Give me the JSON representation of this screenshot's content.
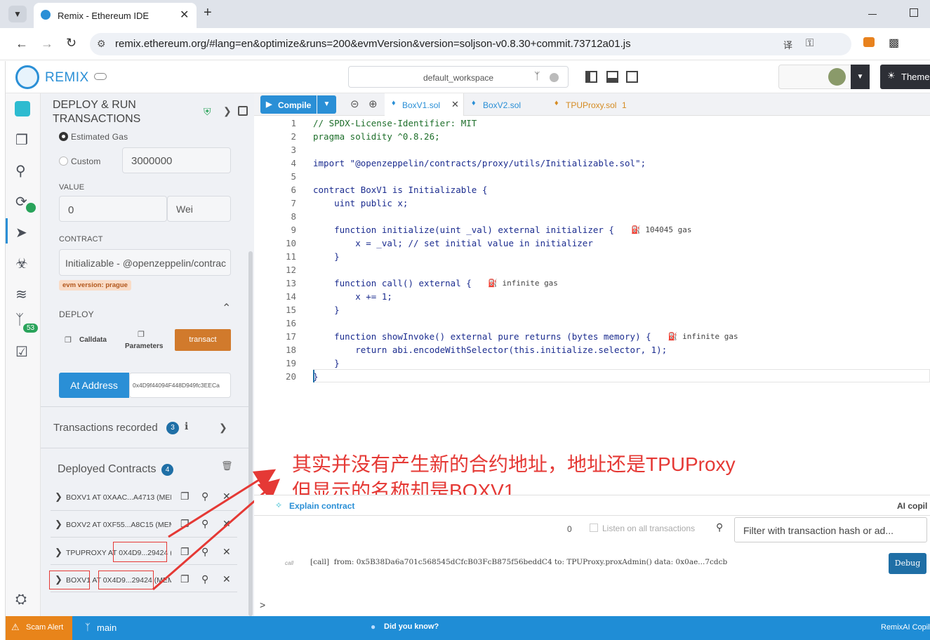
{
  "browser": {
    "tab_title": "Remix - Ethereum IDE",
    "url": "remix.ethereum.org/#lang=en&optimize&runs=200&evmVersion&version=soljson-v0.8.30+commit.73712a01.js"
  },
  "header": {
    "brand": "REMIX",
    "workspace": "default_workspace",
    "theme_label": "Theme"
  },
  "iconbar": {
    "badge_count": "53"
  },
  "side": {
    "title_line1": "DEPLOY & RUN",
    "title_line2": "TRANSACTIONS",
    "gas_estimated": "Estimated Gas",
    "gas_custom": "Custom",
    "gas_custom_value": "3000000",
    "value_label": "VALUE",
    "value_amount": "0",
    "value_unit": "Wei",
    "contract_label": "CONTRACT",
    "contract_value": "Initializable - @openzeppelin/contrac",
    "evm_badge": "evm version: prague",
    "deploy_label": "DEPLOY",
    "calldata_label": "Calldata",
    "parameters_label": "Parameters",
    "transact_label": "transact",
    "at_address_label": "At Address",
    "at_address_value": "0x4D9f44094F448D949fc3EECa",
    "tx_recorded": "Transactions recorded",
    "tx_count": "3",
    "deployed_label": "Deployed Contracts",
    "deployed_count": "4",
    "deployed": [
      {
        "name": "BOXV1 AT 0XAAC...A4713 (MEM"
      },
      {
        "name": "BOXV2 AT 0XF55...A8C15 (MEM"
      },
      {
        "name": "TPUPROXY AT 0X4D9...29424 (M"
      },
      {
        "name": "BOXV1 AT 0X4D9...29424 (MEM"
      }
    ]
  },
  "editor": {
    "compile_label": "Compile",
    "tabs": [
      {
        "label": "BoxV1.sol",
        "badge": ""
      },
      {
        "label": "BoxV2.sol",
        "badge": ""
      },
      {
        "label": "TPUProxy.sol",
        "badge": "1"
      }
    ],
    "lines": [
      "// SPDX-License-Identifier: MIT",
      "pragma solidity ^0.8.26;",
      "",
      "import \"@openzeppelin/contracts/proxy/utils/Initializable.sol\";",
      "",
      "contract BoxV1 is Initializable {",
      "    uint public x;",
      "",
      "    function initialize(uint _val) external initializer {",
      "        x = _val; // set initial value in initializer",
      "    }",
      "",
      "    function call() external {",
      "        x += 1;",
      "    }",
      "",
      "    function showInvoke() external pure returns (bytes memory) {",
      "        return abi.encodeWithSelector(this.initialize.selector, 1);",
      "    }",
      "}"
    ],
    "gas_hints": [
      {
        "line": 9,
        "text": "104045 gas"
      },
      {
        "line": 13,
        "text": "infinite gas"
      },
      {
        "line": 17,
        "text": "infinite gas"
      }
    ]
  },
  "annotation": {
    "line1": "其实并没有产生新的合约地址，地址还是TPUProxy",
    "line2": "但显示的名称却是BOXV1"
  },
  "terminal": {
    "explain_label": "Explain contract",
    "ai_label": "AI copil",
    "count": "0",
    "listen_label": "Listen on all transactions",
    "filter_placeholder": "Filter with transaction hash or ad...",
    "call_tag": "call",
    "log_line": "[call]  from: 0x5B38Da6a701c568545dCfcB03FcB875f56beddC4 to: TPUProxy.proxAdmin() data: 0x0ae...7cdcb",
    "debug_label": "Debug",
    "prompt": ">"
  },
  "status": {
    "scam_alert": "Scam Alert",
    "branch": "main",
    "did_you_know": "Did you know?",
    "remixai": "RemixAI Copil"
  }
}
